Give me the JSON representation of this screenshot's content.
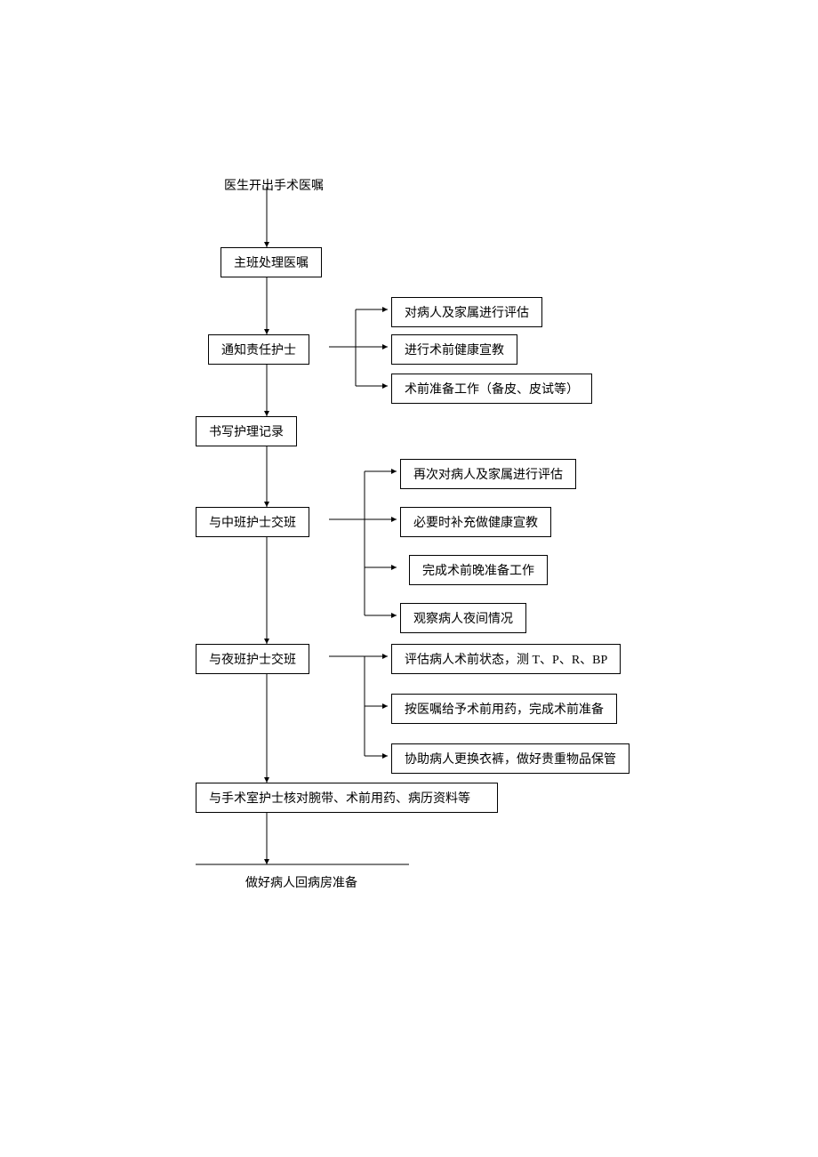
{
  "flowchart": {
    "title_top": "医生开出手术医嘱",
    "main_nodes": {
      "n1": "主班处理医嘱",
      "n2": "通知责任护士",
      "n3": "书写护理记录",
      "n4": "与中班护士交班",
      "n5": "与夜班护士交班",
      "n6": "与手术室护士核对腕带、术前用药、病历资料等",
      "n7": "做好病人回病房准备"
    },
    "side_nodes": {
      "s2a": "对病人及家属进行评估",
      "s2b": "进行术前健康宣教",
      "s2c": "术前准备工作（备皮、皮试等）",
      "s4a": "再次对病人及家属进行评估",
      "s4b": "必要时补充做健康宣教",
      "s4c": "完成术前晚准备工作",
      "s4d": "观察病人夜间情况",
      "s5a": "评估病人术前状态，测 T、P、R、BP",
      "s5b": "按医嘱给予术前用药，完成术前准备",
      "s5c": "协助病人更换衣裤，做好贵重物品保管"
    }
  }
}
